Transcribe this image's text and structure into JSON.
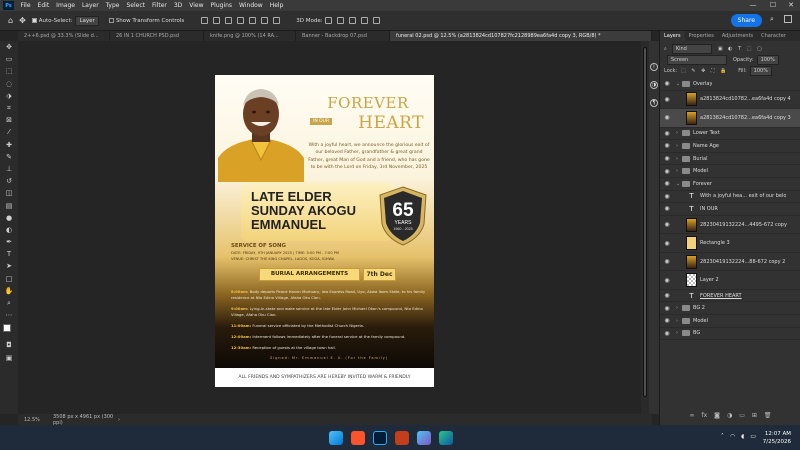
{
  "menu": {
    "app_logo": "Ps",
    "items": [
      "File",
      "Edit",
      "Image",
      "Layer",
      "Type",
      "Select",
      "Filter",
      "3D",
      "View",
      "Plugins",
      "Window",
      "Help"
    ],
    "window_controls": [
      "—",
      "☐",
      "✕"
    ]
  },
  "options": {
    "auto_select_label": "Auto-Select:",
    "auto_select_value": "Layer",
    "transform_label": "Show Transform Controls",
    "mode_3d": "3D Mode:",
    "share_label": "Share"
  },
  "tabs": [
    "2++6.psd @ 33.3% (Slide d...",
    "26 IN 1 CHURCH PSD.psd",
    "knife.png @ 100% (14 RA...",
    "Banner - Backdrop 07.psd",
    "funeral 02.psd @ 12.5% (a2813824cd107827fc2128989ea6fa4d copy 3, RGB/8) *"
  ],
  "status": {
    "zoom": "12.5%",
    "dimensions": "3508 px x 4961 px (300 ppi)"
  },
  "poster": {
    "title_line1": "FOREVER",
    "in_our": "IN OUR",
    "title_line2": "HEART",
    "intro": "With a joyful heart, we announce the glorious exit of our beloved Father, grandfather & great grand Father, great Man of God and a friend, who has gone to be with the Lord on Friday, 3rd November, 2025",
    "name_line1": "LATE ELDER",
    "name_line2": "SUNDAY AKOGU",
    "name_line3": "EMMANUEL",
    "age": "65",
    "age_label": "YEARS",
    "years": "1960 - 2025",
    "service_title": "SERVICE OF SONG",
    "service_date": "DATE: FRIDAY, 9TH JANUARY 2025 | TIME: 5:00 PM - 7:00 PM",
    "service_venue": "VENUE: CHRIST THE KING CHAPEL, LAGOS, KOGA, IGHWA",
    "burial_label": "BURIAL ARRANGEMENTS",
    "burial_date": "7th Dec",
    "program": [
      {
        "time": "8:00am:",
        "text": "Body departs Peace Haven Mortuary, Iwo Express Road, Uyo, Akwa Ibom State, to his family residence at Nto Edino Village, Afaha Oku Clan."
      },
      {
        "time": "9:00am:",
        "text": "Lying-in-state and wake service at the late Elder John Michael Okon's compound, Nto Edino Village, Afaha Oku Clan."
      },
      {
        "time": "11:00am:",
        "text": "Funeral service officiated by the Methodist Church Nigeria."
      },
      {
        "time": "12:00am:",
        "text": "Interment follows immediately after the funeral service at the family compound."
      },
      {
        "time": "12:30am:",
        "text": "Reception of guests at the village town hall."
      }
    ],
    "signed": "Signed: Mr. Emmanuel E. U. (For the Family)",
    "footer": "ALL FRIENDS AND SYMPATHIZERS ARE HEREBY INVITED WARM & FRIENDLY"
  },
  "panel": {
    "tabs": [
      "Layers",
      "Properties",
      "Adjustments",
      "Character"
    ],
    "kind": "Kind",
    "blend_mode": "Screen",
    "opacity_label": "Opacity:",
    "opacity": "100%",
    "lock_label": "Lock:",
    "fill_label": "Fill:",
    "fill": "100%",
    "layers": [
      {
        "name": "Overlay",
        "type": "folder",
        "indent": 0,
        "open": true
      },
      {
        "name": "a2813824cd10782...ea6fa4d copy 4",
        "type": "image",
        "indent": 1
      },
      {
        "name": "a2813824cd10782...ea6fa4d copy 3",
        "type": "image",
        "indent": 1,
        "selected": true
      },
      {
        "name": "Lower Text",
        "type": "folder",
        "indent": 0
      },
      {
        "name": "Name Age",
        "type": "folder",
        "indent": 0
      },
      {
        "name": "Burial",
        "type": "folder",
        "indent": 0
      },
      {
        "name": "Model",
        "type": "folder",
        "indent": 0
      },
      {
        "name": "Forever",
        "type": "folder",
        "indent": 0,
        "open": true
      },
      {
        "name": "With a joyful hea... exit of our belo",
        "type": "text",
        "indent": 1
      },
      {
        "name": "IN OUR",
        "type": "text",
        "indent": 1
      },
      {
        "name": "28230419132224...4495-672 copy",
        "type": "image",
        "indent": 1
      },
      {
        "name": "Rectangle 3",
        "type": "shape",
        "indent": 1
      },
      {
        "name": "28230419132224...88-672 copy 2",
        "type": "image",
        "indent": 1
      },
      {
        "name": "Layer 2",
        "type": "checker",
        "indent": 1
      },
      {
        "name": "FOREVER HEART",
        "type": "text",
        "indent": 1
      },
      {
        "name": "BG 2",
        "type": "folder",
        "indent": 0
      },
      {
        "name": "Model",
        "type": "folder",
        "indent": 0
      },
      {
        "name": "BG",
        "type": "folder",
        "indent": 0
      }
    ],
    "bottom_icons": [
      "link-icon",
      "fx-icon",
      "mask-icon",
      "adjustment-icon",
      "group-icon",
      "new-layer-icon",
      "delete-icon"
    ]
  },
  "taskbar": {
    "time": "12:07 AM",
    "date": "7/25/2026",
    "apps": [
      "windows-start",
      "brave-browser",
      "photoshop",
      "powerpoint",
      "photos",
      "edge-browser"
    ]
  },
  "colors": {
    "accent_blue": "#1473e6",
    "poster_gold": "#cba544"
  }
}
